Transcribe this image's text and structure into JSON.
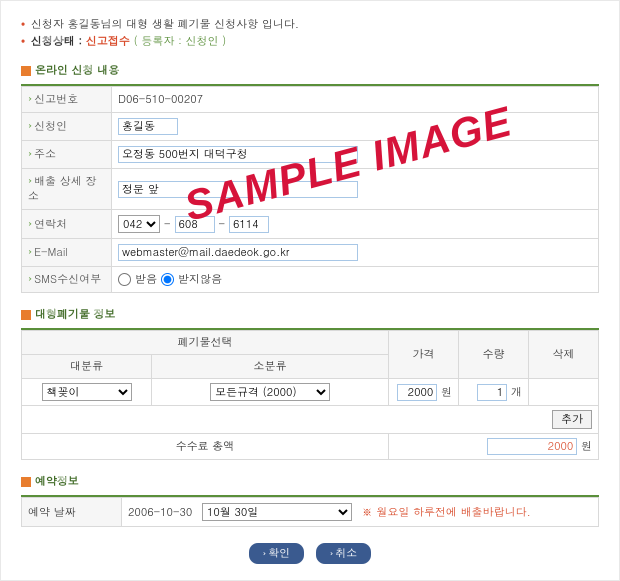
{
  "notice": {
    "line1": "신청자 홍길동님의 대형 생활 폐기물 신청사항 입니다.",
    "status_label": "신청상태 : ",
    "status_value": "신고접수",
    "reg_open": " ( 등록자 : ",
    "reg_value": "신청인",
    "reg_close": " )"
  },
  "section1": {
    "title": "온라인 신청 내용"
  },
  "info": {
    "report_no_label": "신고번호",
    "report_no": "D06-510-00207",
    "applicant_label": "신청인",
    "applicant": "홍길동",
    "address_label": "주소",
    "address": "오정동 500번지 대덕구청",
    "spot_label": "배출 상세 장소",
    "spot": "정문 앞",
    "phone_label": "연락처",
    "phone_area": "042",
    "phone_mid": "608",
    "phone_last": "6114",
    "email_label": "E-Mail",
    "email": "webmaster@mail.daedeok.go.kr",
    "sms_label": "SMS수신여부",
    "sms_yes": "받음",
    "sms_no": "받지않음"
  },
  "section2": {
    "title": "대형폐기물 정보"
  },
  "waste": {
    "sel_header": "폐기물선택",
    "cat1_header": "대분류",
    "cat2_header": "소분류",
    "price_header": "가격",
    "qty_header": "수량",
    "del_header": "삭제",
    "cat1_value": "책꽂이",
    "cat2_value": "모든규격 (2000)",
    "price_value": "2000",
    "price_unit": "원",
    "qty_value": "1",
    "qty_unit": "개",
    "add_btn": "추가",
    "total_label": "수수료 총액",
    "total_value": "2000",
    "total_unit": "원"
  },
  "section3": {
    "title": "예약정보"
  },
  "reserve": {
    "date_label": "예약 날짜",
    "date_text": "2006-10-30",
    "date_select": "10월 30일",
    "note": "※ 월요일 하루전에 배출바랍니다."
  },
  "buttons": {
    "ok": "확인",
    "cancel": "취소"
  },
  "watermark": "SAMPLE IMAGE"
}
